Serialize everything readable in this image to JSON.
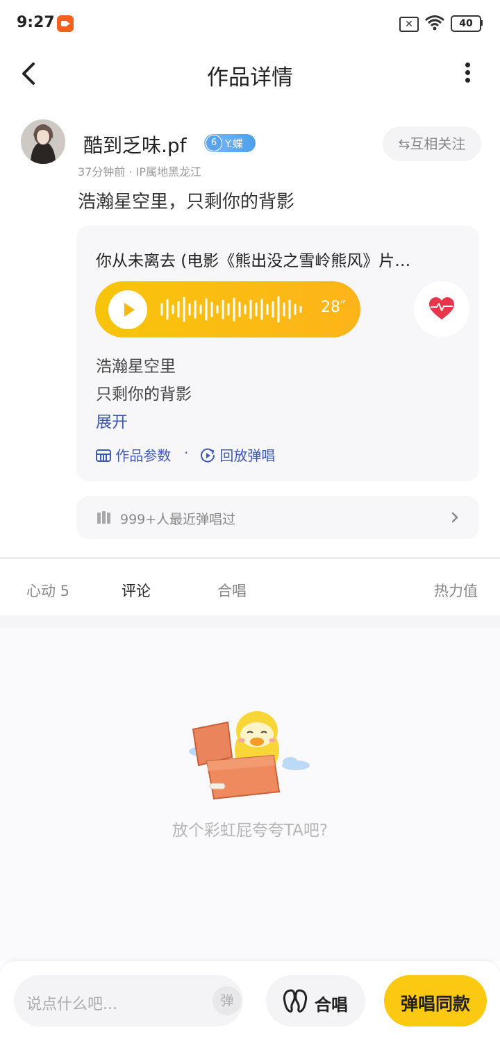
{
  "status_bar": {
    "time": "9:27",
    "battery": "40"
  },
  "header": {
    "title": "作品详情"
  },
  "author": {
    "name": "酷到乏味.pf",
    "badge_level": "6",
    "badge_text": "Y.蝶",
    "follow_label": "⇆互相关注",
    "meta": "37分钟前 · IP属地黑龙江"
  },
  "post": {
    "text": "浩瀚星空里，只剩你的背影"
  },
  "work_card": {
    "song_title": "你从未离去 (电影《熊出没之雪岭熊风》片…",
    "duration": "28″",
    "lyrics": [
      "浩瀚星空里",
      "只剩你的背影"
    ],
    "expand_label": "展开",
    "params_label": "作品参数",
    "separator": "·",
    "replay_label": "回放弹唱"
  },
  "recent": {
    "text": "999+人最近弹唱过"
  },
  "tabs": {
    "hearts": "心动 5",
    "comments": "评论",
    "chorus": "合唱",
    "heat": "热力值"
  },
  "empty_state": {
    "text": "放个彩虹屁夸夸TA吧?"
  },
  "bottom_bar": {
    "input_placeholder": "说点什么吧...",
    "danmu_label": "弹",
    "chorus_label": "合唱",
    "sing_label": "弹唱同款"
  },
  "colors": {
    "accent_yellow": "#fbc812",
    "link_blue": "#3e58b8",
    "heart_red": "#e8354a"
  }
}
